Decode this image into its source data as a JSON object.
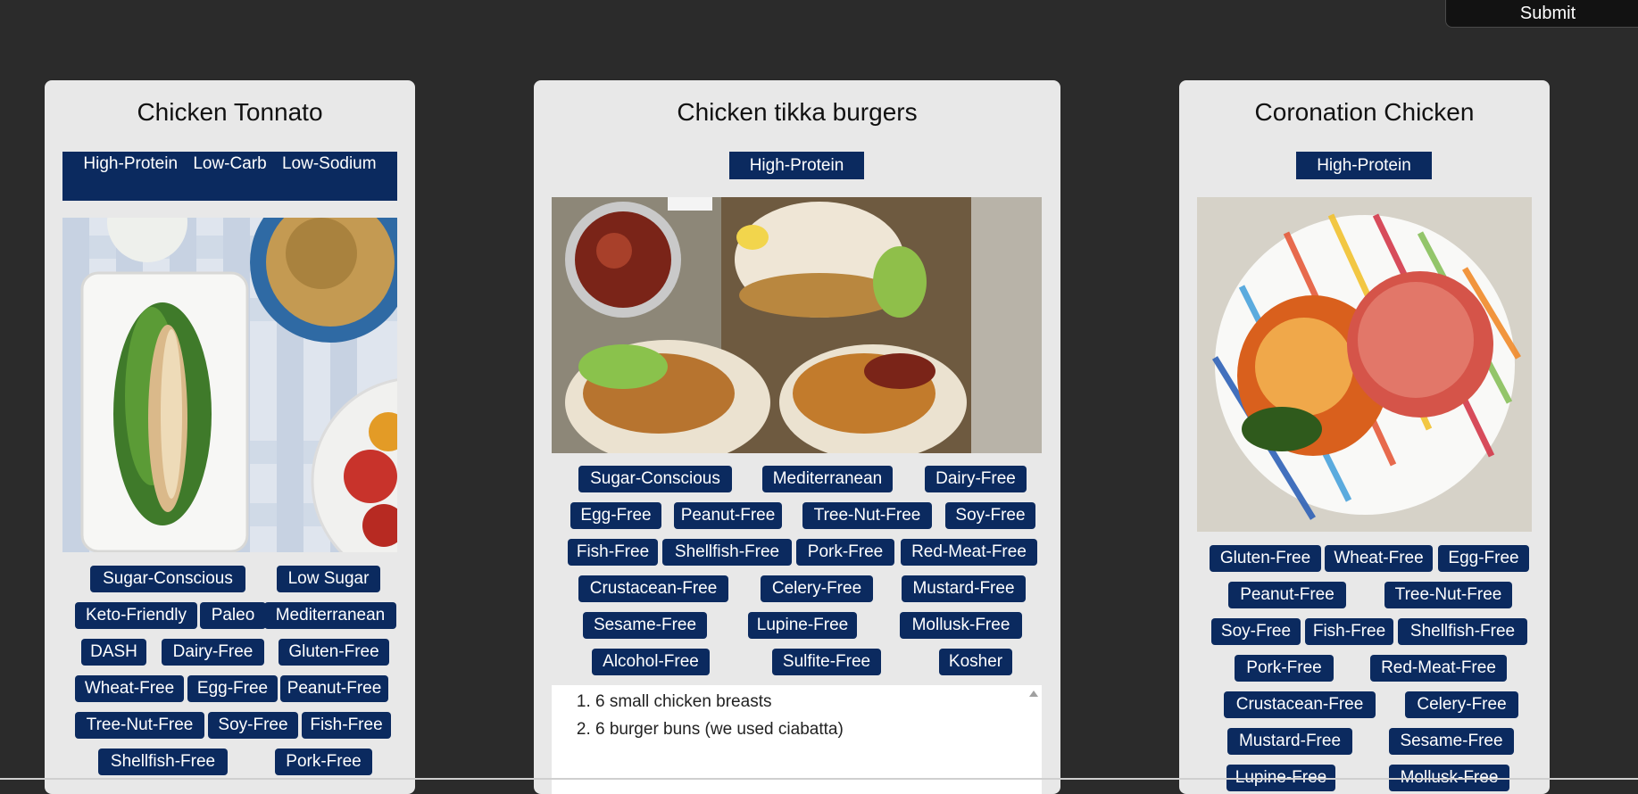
{
  "header": {
    "submit_label": "Submit"
  },
  "recipes": [
    {
      "title": "Chicken Tonnato",
      "diet_labels": [
        "High-Protein",
        "Low-Carb",
        "Low-Sodium"
      ],
      "health_labels": [
        "Sugar-Conscious",
        "Low Sugar",
        "Keto-Friendly",
        "Paleo",
        "Mediterranean",
        "DASH",
        "Dairy-Free",
        "Gluten-Free",
        "Wheat-Free",
        "Egg-Free",
        "Peanut-Free",
        "Tree-Nut-Free",
        "Soy-Free",
        "Fish-Free",
        "Shellfish-Free",
        "Pork-Free"
      ]
    },
    {
      "title": "Chicken tikka burgers",
      "diet_labels": [
        "High-Protein"
      ],
      "health_labels": [
        "Sugar-Conscious",
        "Mediterranean",
        "Dairy-Free",
        "Egg-Free",
        "Peanut-Free",
        "Tree-Nut-Free",
        "Soy-Free",
        "Fish-Free",
        "Shellfish-Free",
        "Pork-Free",
        "Red-Meat-Free",
        "Crustacean-Free",
        "Celery-Free",
        "Mustard-Free",
        "Sesame-Free",
        "Lupine-Free",
        "Mollusk-Free",
        "Alcohol-Free",
        "Sulfite-Free",
        "Kosher"
      ],
      "ingredients": [
        "6 small chicken breasts",
        "6 burger buns (we used ciabatta)"
      ]
    },
    {
      "title": "Coronation Chicken",
      "diet_labels": [
        "High-Protein"
      ],
      "health_labels": [
        "Gluten-Free",
        "Wheat-Free",
        "Egg-Free",
        "Peanut-Free",
        "Tree-Nut-Free",
        "Soy-Free",
        "Fish-Free",
        "Shellfish-Free",
        "Pork-Free",
        "Red-Meat-Free",
        "Crustacean-Free",
        "Celery-Free",
        "Mustard-Free",
        "Sesame-Free",
        "Lupine-Free",
        "Mollusk-Free"
      ]
    }
  ],
  "colors": {
    "background": "#2b2b2b",
    "card": "#e8e8e8",
    "badge": "#0b2a5f",
    "badge_text": "#ffffff"
  }
}
